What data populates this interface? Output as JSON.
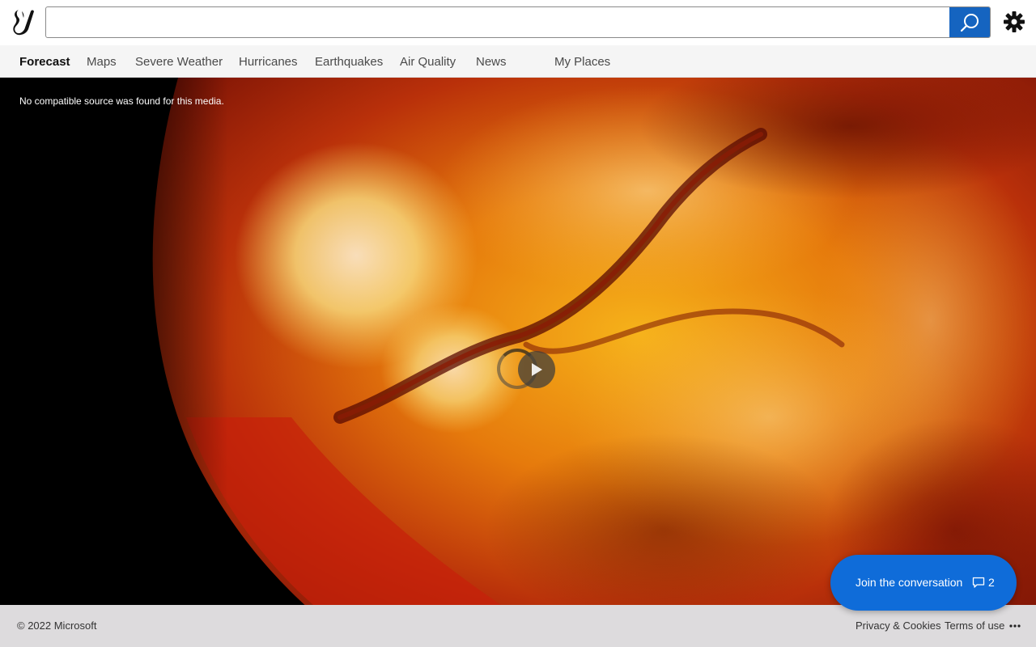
{
  "header": {
    "search": {
      "value": "",
      "placeholder": ""
    },
    "logo_icon": "bing-weather-logo-icon",
    "search_icon": "search-icon",
    "settings_icon": "gear-icon"
  },
  "nav": {
    "items": [
      {
        "label": "Forecast",
        "active": true
      },
      {
        "label": "Maps"
      },
      {
        "label": "Severe Weather"
      },
      {
        "label": "Hurricanes"
      },
      {
        "label": "Earthquakes"
      },
      {
        "label": "Air Quality"
      },
      {
        "label": "News"
      },
      {
        "label": "My Places"
      }
    ]
  },
  "media": {
    "error_message": "No compatible source was found for this media.",
    "play_icon": "play-icon"
  },
  "conversation": {
    "label": "Join the conversation",
    "count": "2",
    "icon": "comment-icon",
    "color": "#0f6cd9"
  },
  "footer": {
    "copyright": "© 2022 Microsoft",
    "links": [
      "Privacy & Cookies",
      "Terms of use"
    ],
    "more_icon": "more-icon"
  },
  "colors": {
    "search_button": "#1564c0",
    "nav_background": "#f5f5f5"
  }
}
